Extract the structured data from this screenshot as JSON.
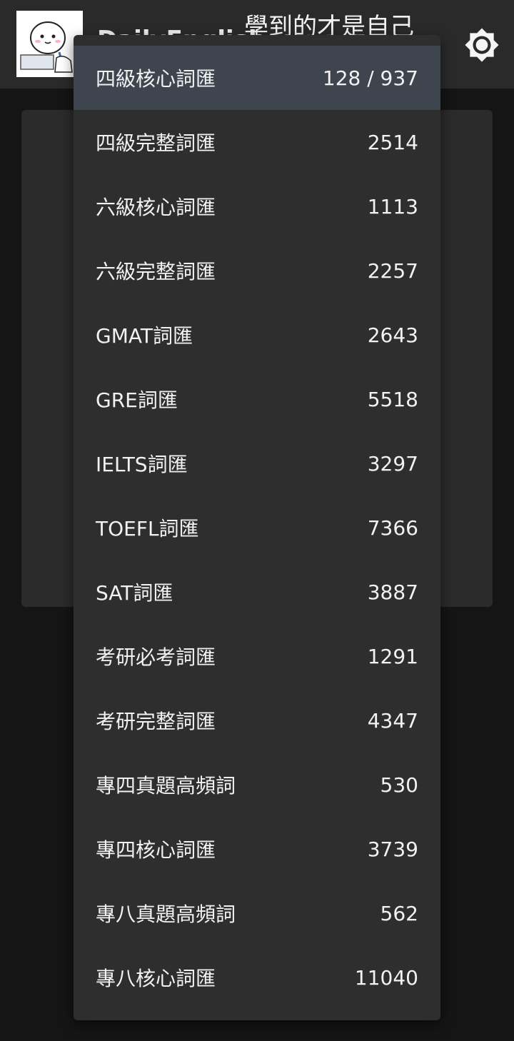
{
  "header": {
    "app_title": "DailyEnglish",
    "slogan": "學到的才是自己",
    "avatar_icon": "cartoon-mascot-icon",
    "theme_icon": "brightness-icon"
  },
  "menu": {
    "items": [
      {
        "label": "四級核心詞匯",
        "count": "128 / 937",
        "selected": true
      },
      {
        "label": "四級完整詞匯",
        "count": "2514"
      },
      {
        "label": "六級核心詞匯",
        "count": "1113"
      },
      {
        "label": "六級完整詞匯",
        "count": "2257"
      },
      {
        "label": "GMAT詞匯",
        "count": "2643"
      },
      {
        "label": "GRE詞匯",
        "count": "5518"
      },
      {
        "label": "IELTS詞匯",
        "count": "3297"
      },
      {
        "label": "TOEFL詞匯",
        "count": "7366"
      },
      {
        "label": "SAT詞匯",
        "count": "3887"
      },
      {
        "label": "考研必考詞匯",
        "count": "1291"
      },
      {
        "label": "考研完整詞匯",
        "count": "4347"
      },
      {
        "label": "專四真題高頻詞",
        "count": "530"
      },
      {
        "label": "專四核心詞匯",
        "count": "3739"
      },
      {
        "label": "專八真題高頻詞",
        "count": "562"
      },
      {
        "label": "專八核心詞匯",
        "count": "11040"
      }
    ]
  },
  "colors": {
    "appbar_bg": "#2a2a2a",
    "menu_bg": "#2e2e2e",
    "selected_bg": "#3e454e",
    "page_bg": "#151515"
  }
}
